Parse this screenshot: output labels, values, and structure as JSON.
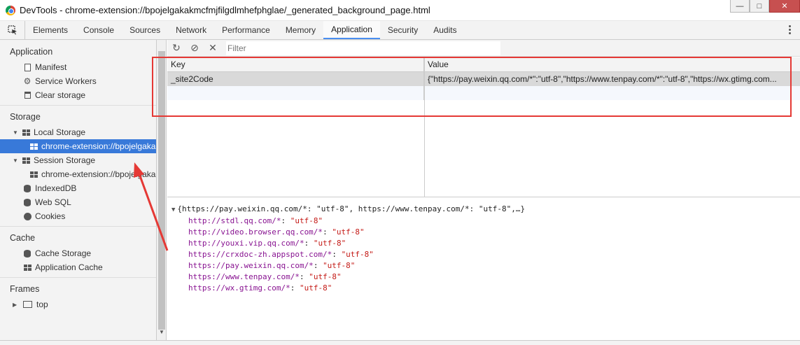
{
  "window": {
    "title": "DevTools - chrome-extension://bpojelgakakmcfmjfilgdlmhefphglae/_generated_background_page.html",
    "controls": {
      "minimize": "—",
      "maximize": "□",
      "close": "✕"
    }
  },
  "tabs": [
    "Elements",
    "Console",
    "Sources",
    "Network",
    "Performance",
    "Memory",
    "Application",
    "Security",
    "Audits"
  ],
  "active_tab": "Application",
  "sidebar": {
    "application": {
      "header": "Application",
      "items": [
        "Manifest",
        "Service Workers",
        "Clear storage"
      ]
    },
    "storage": {
      "header": "Storage",
      "local_storage": "Local Storage",
      "local_storage_origin": "chrome-extension://bpojelgakakmcfmjfilgdlmhefphglae",
      "session_storage": "Session Storage",
      "session_storage_origin": "chrome-extension://bpojelgakakmcfmjfilgdlmhefphglae",
      "indexeddb": "IndexedDB",
      "websql": "Web SQL",
      "cookies": "Cookies"
    },
    "cache": {
      "header": "Cache",
      "items": [
        "Cache Storage",
        "Application Cache"
      ]
    },
    "frames": {
      "header": "Frames",
      "top": "top"
    }
  },
  "toolbar": {
    "refresh_icon": "↻",
    "clear_icon": "⊘",
    "delete_icon": "✕",
    "filter_placeholder": "Filter"
  },
  "table": {
    "columns": [
      "Key",
      "Value"
    ],
    "rows": [
      {
        "key": "_site2Code",
        "value": "{\"https://pay.weixin.qq.com/*\":\"utf-8\",\"https://www.tenpay.com/*\":\"utf-8\",\"https://wx.gtimg.com..."
      }
    ]
  },
  "preview": {
    "summary": "{https://pay.weixin.qq.com/*: \"utf-8\", https://www.tenpay.com/*: \"utf-8\",…}",
    "entries": [
      {
        "key": "http://stdl.qq.com/*",
        "value": "\"utf-8\""
      },
      {
        "key": "http://video.browser.qq.com/*",
        "value": "\"utf-8\""
      },
      {
        "key": "http://youxi.vip.qq.com/*",
        "value": "\"utf-8\""
      },
      {
        "key": "https://crxdoc-zh.appspot.com/*",
        "value": "\"utf-8\""
      },
      {
        "key": "https://pay.weixin.qq.com/*",
        "value": "\"utf-8\""
      },
      {
        "key": "https://www.tenpay.com/*",
        "value": "\"utf-8\""
      },
      {
        "key": "https://wx.gtimg.com/*",
        "value": "\"utf-8\""
      }
    ]
  },
  "colors": {
    "selected_bg": "#3879d9",
    "tab_underline": "#4a8ef0",
    "annotation_red": "#e53935",
    "preview_key": "#881391",
    "preview_value": "#c41a16"
  }
}
